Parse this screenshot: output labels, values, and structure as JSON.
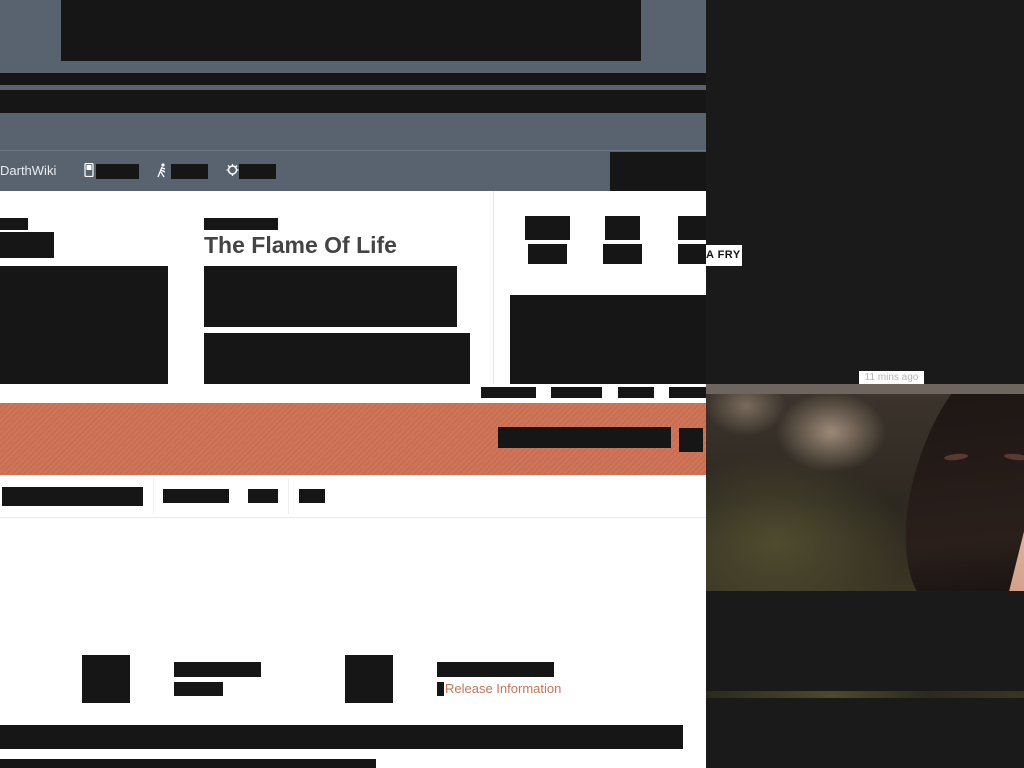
{
  "site": {
    "nav_logo": "DarthWiki"
  },
  "nav_icons": [
    "phone-icon",
    "walking-figure-icon",
    "gear-bug-icon"
  ],
  "article": {
    "title": "The Flame Of Life"
  },
  "links": {
    "release_information": "Release Information"
  },
  "side_panel": {
    "label": "A FRY",
    "time_ago": "11 mins ago"
  },
  "colors": {
    "header_bg": "#58636f",
    "promo_bg": "#cf7558",
    "link": "#c2765b",
    "redaction": "#161616"
  }
}
